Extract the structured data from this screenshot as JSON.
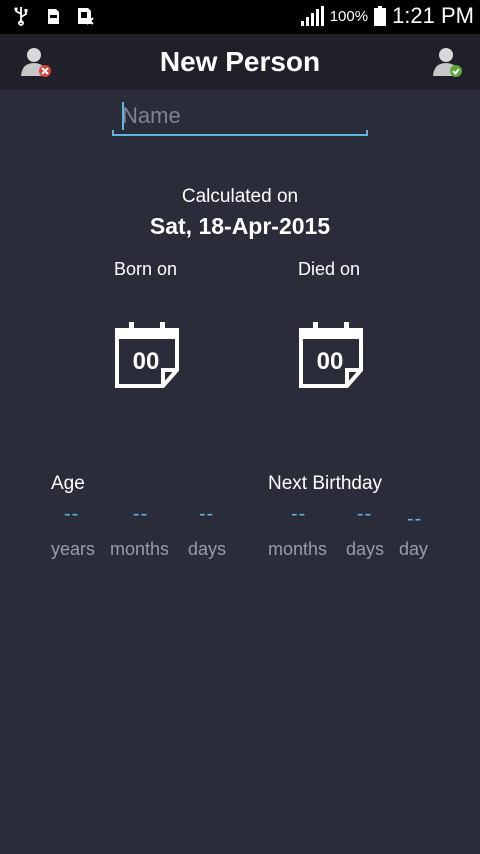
{
  "status_bar": {
    "battery_percent": "100%",
    "time": "1:21 PM",
    "icons": [
      "usb-icon",
      "sd-card-icon",
      "sim-card-icon",
      "signal-icon",
      "battery-icon"
    ]
  },
  "action_bar": {
    "title": "New Person",
    "left_icon": "delete-person-icon",
    "right_icon": "save-person-icon"
  },
  "form": {
    "name_placeholder": "Name",
    "name_value": ""
  },
  "calculated": {
    "label": "Calculated on",
    "date": "Sat, 18-Apr-2015"
  },
  "born": {
    "label": "Born on",
    "calendar_value": "00"
  },
  "died": {
    "label": "Died on",
    "calendar_value": "00"
  },
  "age": {
    "label": "Age",
    "values": [
      "--",
      "--",
      "--"
    ],
    "units": [
      "years",
      "months",
      "days"
    ]
  },
  "next_birthday": {
    "label": "Next Birthday",
    "values": [
      "--",
      "--",
      "--"
    ],
    "units": [
      "months",
      "days",
      "day"
    ]
  },
  "colors": {
    "background": "#2a2c3a",
    "action_bar": "#1f2029",
    "accent": "#5ab6dd",
    "muted_text": "#9a9ca6"
  }
}
